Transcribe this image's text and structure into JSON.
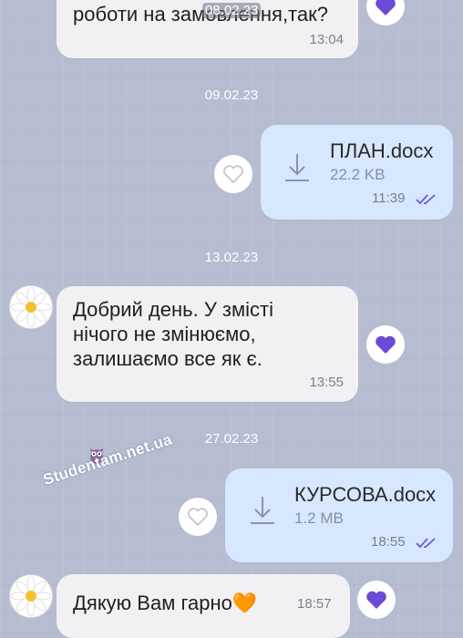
{
  "chat": {
    "top_fragment": {
      "text": "роботи на замовлення,так?",
      "time": "13:04",
      "overlay_date": "08.02.23"
    },
    "dates": {
      "d1": "09.02.23",
      "d2": "13.02.23",
      "d3": "27.02.23"
    },
    "file1": {
      "name": "ПЛАН.docx",
      "size": "22.2 KB",
      "time": "11:39"
    },
    "msg2": {
      "text": "Добрий день. У змісті\nнічого не змінюємо,\nзалишаємо все як є.",
      "time": "13:55"
    },
    "file2": {
      "name": "КУРСОВА.docx",
      "size": "1.2 MB",
      "time": "18:55"
    },
    "msg3": {
      "text": "Дякую Вам гарно",
      "emoji": "🧡",
      "time": "18:57"
    }
  },
  "watermark": {
    "text": "Studentam.net.ua"
  },
  "colors": {
    "background": "#b6bdd0",
    "incoming_bubble": "#f1f1f4",
    "outgoing_bubble": "#d6e7ff",
    "like_purple": "#6a4bd8",
    "read_check": "#6a5bd8"
  },
  "icons": {
    "like_filled": "heart-filled-icon",
    "like_empty": "heart-outline-icon",
    "download": "download-icon",
    "read_receipt": "double-check-icon",
    "avatar": "daisy-avatar-icon"
  }
}
